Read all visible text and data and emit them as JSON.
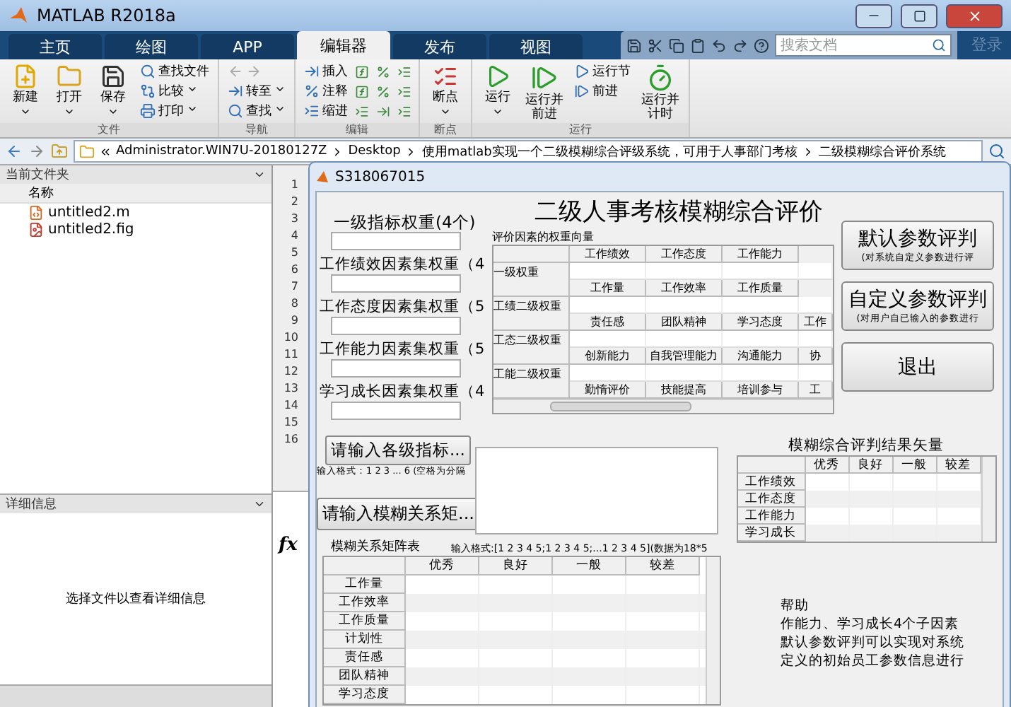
{
  "window": {
    "title": "MATLAB R2018a"
  },
  "tabs": [
    {
      "label": "主页",
      "selected": false
    },
    {
      "label": "绘图",
      "selected": false
    },
    {
      "label": "APP",
      "selected": false
    },
    {
      "label": "编辑器",
      "selected": true
    },
    {
      "label": "发布",
      "selected": false
    },
    {
      "label": "视图",
      "selected": false
    }
  ],
  "search": {
    "placeholder": "搜索文档"
  },
  "login": "登录",
  "ribbon": [
    {
      "label": "文件",
      "items": [
        {
          "kind": "large",
          "label": "新建",
          "menu": true
        },
        {
          "kind": "large",
          "label": "打开",
          "menu": true
        },
        {
          "kind": "large",
          "label": "保存",
          "menu": true
        },
        {
          "kind": "small",
          "label": "查找文件",
          "menu": false
        },
        {
          "kind": "small",
          "label": "比较",
          "menu": true
        },
        {
          "kind": "small",
          "label": "打印",
          "menu": true
        }
      ]
    },
    {
      "label": "导航",
      "items": [
        {
          "kind": "arrows"
        },
        {
          "kind": "small",
          "label": "转至",
          "menu": true
        },
        {
          "kind": "small",
          "label": "查找",
          "menu": true
        }
      ]
    },
    {
      "label": "编辑",
      "items": [
        {
          "kind": "small",
          "label": "插入",
          "menu": false
        },
        {
          "kind": "small",
          "label": "注释",
          "menu": false
        },
        {
          "kind": "small",
          "label": "缩进",
          "menu": false
        },
        {
          "kind": "icons"
        }
      ]
    },
    {
      "label": "断点",
      "items": [
        {
          "kind": "large",
          "label": "断点",
          "menu": true
        }
      ]
    },
    {
      "label": "运行",
      "items": [
        {
          "kind": "large",
          "label": "运行",
          "menu": true
        },
        {
          "kind": "large",
          "label": "运行并前进",
          "menu": false
        },
        {
          "kind": "small",
          "label": "运行节",
          "menu": false
        },
        {
          "kind": "small",
          "label": "前进",
          "menu": false
        },
        {
          "kind": "large",
          "label": "运行并计时",
          "menu": false
        }
      ]
    }
  ],
  "address": [
    "Administrator.WIN7U-20180127Z",
    "Desktop",
    "使用matlab实现一个二级模糊综合评级系统，可用于人事部门考核",
    "二级模糊综合评价系统"
  ],
  "file_browser": {
    "title": "当前文件夹",
    "column": "名称",
    "files": [
      {
        "name": "untitled2.m",
        "kind": "script"
      },
      {
        "name": "untitled2.fig",
        "kind": "figure"
      }
    ]
  },
  "details": {
    "title": "详细信息",
    "message": "选择文件以查看详细信息"
  },
  "editor": {
    "line_numbers": [
      "1",
      "2",
      "3",
      "4",
      "5",
      "6",
      "7",
      "8",
      "9",
      "10",
      "11",
      "12",
      "13",
      "14",
      "15",
      "16"
    ]
  },
  "command_window": {
    "prompt": "fx"
  },
  "dialog": {
    "title": "S318067015",
    "heading": "二级人事考核模糊综合评价",
    "weight_inputs": [
      "一级指标权重(4个)",
      "工作绩效因素集权重（4",
      "工作态度因素集权重（5",
      "工作能力因素集权重（5",
      "学习成长因素集权重（4"
    ],
    "input_button": "请输入各级指标...",
    "input_format": "输入格式：1 2 3 ... 6 (空格为分隔",
    "matrix_button": "请输入模糊关系矩...",
    "weights_title": "评价因素的权重向量",
    "weight_tables": [
      {
        "columns": [
          "工作绩效",
          "工作态度",
          "工作能力"
        ],
        "row_label": "一级权重"
      },
      {
        "columns": [
          "工作量",
          "工作效率",
          "工作质量"
        ],
        "row_label": "工绩二级权重"
      },
      {
        "columns": [
          "责任感",
          "团队精神",
          "学习态度",
          "工作"
        ],
        "row_label": "工态二级权重"
      },
      {
        "columns": [
          "创新能力",
          "自我管理能力",
          "沟通能力",
          "协"
        ],
        "row_label": "工能二级权重"
      },
      {
        "columns": [
          "勤惰评价",
          "技能提高",
          "培训参与",
          "工"
        ]
      }
    ],
    "actions": [
      {
        "label": "默认参数评判",
        "note": "(对系统自定义参数进行评"
      },
      {
        "label": "自定义参数评判",
        "note": "(对用户自已输入的参数进行"
      },
      {
        "label": "退出"
      }
    ],
    "matrix_format": "输入格式:[1 2 3 4 5;1 2 3 4 5;...1 2 3 4 5](数据为18*5",
    "results": {
      "title": "模糊综合评判结果矢量",
      "columns": [
        "优秀",
        "良好",
        "一般",
        "较差"
      ],
      "rows": [
        "工作绩效",
        "工作态度",
        "工作能力",
        "学习成长"
      ]
    },
    "matrix": {
      "title": "模糊关系矩阵表",
      "columns": [
        "优秀",
        "良好",
        "一般",
        "较差"
      ],
      "rows": [
        "工作量",
        "工作效率",
        "工作质量",
        "计划性",
        "责任感",
        "团队精神",
        "学习态度"
      ]
    },
    "help": {
      "title": "帮助",
      "lines": [
        "作能力、学习成长4个子因素",
        "默认参数评判可以实现对系统",
        "定义的初始员工参数信息进行"
      ]
    }
  }
}
